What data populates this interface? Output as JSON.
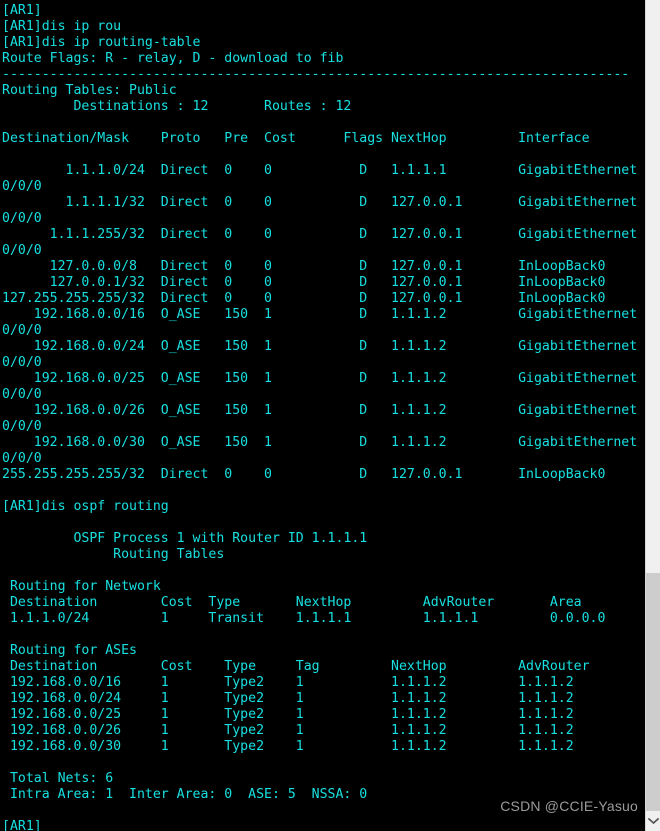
{
  "terminal": {
    "device_prompt": "[AR1]",
    "foreground_color": "#18e0e0",
    "background_color": "#000000",
    "commands": [
      "dis ip rou",
      "dis ip routing-table",
      "dis ospf routing"
    ],
    "lines": [
      "[AR1]",
      "[AR1]dis ip rou",
      "[AR1]dis ip routing-table",
      "Route Flags: R - relay, D - download to fib",
      "-------------------------------------------------------------------------------",
      "Routing Tables: Public",
      "         Destinations : 12       Routes : 12",
      "",
      "Destination/Mask    Proto   Pre  Cost      Flags NextHop         Interface",
      "",
      "        1.1.1.0/24  Direct  0    0           D   1.1.1.1         GigabitEthernet",
      "0/0/0",
      "        1.1.1.1/32  Direct  0    0           D   127.0.0.1       GigabitEthernet",
      "0/0/0",
      "      1.1.1.255/32  Direct  0    0           D   127.0.0.1       GigabitEthernet",
      "0/0/0",
      "      127.0.0.0/8   Direct  0    0           D   127.0.0.1       InLoopBack0",
      "      127.0.0.1/32  Direct  0    0           D   127.0.0.1       InLoopBack0",
      "127.255.255.255/32  Direct  0    0           D   127.0.0.1       InLoopBack0",
      "    192.168.0.0/16  O_ASE   150  1           D   1.1.1.2         GigabitEthernet",
      "0/0/0",
      "    192.168.0.0/24  O_ASE   150  1           D   1.1.1.2         GigabitEthernet",
      "0/0/0",
      "    192.168.0.0/25  O_ASE   150  1           D   1.1.1.2         GigabitEthernet",
      "0/0/0",
      "    192.168.0.0/26  O_ASE   150  1           D   1.1.1.2         GigabitEthernet",
      "0/0/0",
      "    192.168.0.0/30  O_ASE   150  1           D   1.1.1.2         GigabitEthernet",
      "0/0/0",
      "255.255.255.255/32  Direct  0    0           D   127.0.0.1       InLoopBack0",
      "",
      "[AR1]dis ospf routing",
      "",
      "         OSPF Process 1 with Router ID 1.1.1.1",
      "              Routing Tables",
      "",
      " Routing for Network",
      " Destination        Cost  Type       NextHop         AdvRouter       Area",
      " 1.1.1.0/24         1     Transit    1.1.1.1         1.1.1.1         0.0.0.0",
      "",
      " Routing for ASEs",
      " Destination        Cost    Type     Tag         NextHop         AdvRouter",
      " 192.168.0.0/16     1       Type2    1           1.1.1.2         1.1.1.2",
      " 192.168.0.0/24     1       Type2    1           1.1.1.2         1.1.1.2",
      " 192.168.0.0/25     1       Type2    1           1.1.1.2         1.1.1.2",
      " 192.168.0.0/26     1       Type2    1           1.1.1.2         1.1.1.2",
      " 192.168.0.0/30     1       Type2    1           1.1.1.2         1.1.1.2",
      "",
      " Total Nets: 6",
      " Intra Area: 1  Inter Area: 0  ASE: 5  NSSA: 0",
      "",
      "[AR1]"
    ],
    "route_flags_legend": "Route Flags: R - relay, D - download to fib",
    "routing_table_name": "Routing Tables: Public",
    "destinations_count": "12",
    "routes_count": "12",
    "ip_route_table": {
      "headers": [
        "Destination/Mask",
        "Proto",
        "Pre",
        "Cost",
        "Flags",
        "NextHop",
        "Interface"
      ],
      "rows": [
        [
          "1.1.1.0/24",
          "Direct",
          "0",
          "0",
          "D",
          "1.1.1.1",
          "GigabitEthernet0/0/0"
        ],
        [
          "1.1.1.1/32",
          "Direct",
          "0",
          "0",
          "D",
          "127.0.0.1",
          "GigabitEthernet0/0/0"
        ],
        [
          "1.1.1.255/32",
          "Direct",
          "0",
          "0",
          "D",
          "127.0.0.1",
          "GigabitEthernet0/0/0"
        ],
        [
          "127.0.0.0/8",
          "Direct",
          "0",
          "0",
          "D",
          "127.0.0.1",
          "InLoopBack0"
        ],
        [
          "127.0.0.1/32",
          "Direct",
          "0",
          "0",
          "D",
          "127.0.0.1",
          "InLoopBack0"
        ],
        [
          "127.255.255.255/32",
          "Direct",
          "0",
          "0",
          "D",
          "127.0.0.1",
          "InLoopBack0"
        ],
        [
          "192.168.0.0/16",
          "O_ASE",
          "150",
          "1",
          "D",
          "1.1.1.2",
          "GigabitEthernet0/0/0"
        ],
        [
          "192.168.0.0/24",
          "O_ASE",
          "150",
          "1",
          "D",
          "1.1.1.2",
          "GigabitEthernet0/0/0"
        ],
        [
          "192.168.0.0/25",
          "O_ASE",
          "150",
          "1",
          "D",
          "1.1.1.2",
          "GigabitEthernet0/0/0"
        ],
        [
          "192.168.0.0/26",
          "O_ASE",
          "150",
          "1",
          "D",
          "1.1.1.2",
          "GigabitEthernet0/0/0"
        ],
        [
          "192.168.0.0/30",
          "O_ASE",
          "150",
          "1",
          "D",
          "1.1.1.2",
          "GigabitEthernet0/0/0"
        ],
        [
          "255.255.255.255/32",
          "Direct",
          "0",
          "0",
          "D",
          "127.0.0.1",
          "InLoopBack0"
        ]
      ]
    },
    "ospf": {
      "process_header": "OSPF Process 1 with Router ID 1.1.1.1",
      "tables_header": "Routing Tables",
      "network_section_title": "Routing for Network",
      "network_headers": [
        "Destination",
        "Cost",
        "Type",
        "NextHop",
        "AdvRouter",
        "Area"
      ],
      "network_rows": [
        [
          "1.1.1.0/24",
          "1",
          "Transit",
          "1.1.1.1",
          "1.1.1.1",
          "0.0.0.0"
        ]
      ],
      "ase_section_title": "Routing for ASEs",
      "ase_headers": [
        "Destination",
        "Cost",
        "Type",
        "Tag",
        "NextHop",
        "AdvRouter"
      ],
      "ase_rows": [
        [
          "192.168.0.0/16",
          "1",
          "Type2",
          "1",
          "1.1.1.2",
          "1.1.1.2"
        ],
        [
          "192.168.0.0/24",
          "1",
          "Type2",
          "1",
          "1.1.1.2",
          "1.1.1.2"
        ],
        [
          "192.168.0.0/25",
          "1",
          "Type2",
          "1",
          "1.1.1.2",
          "1.1.1.2"
        ],
        [
          "192.168.0.0/26",
          "1",
          "Type2",
          "1",
          "1.1.1.2",
          "1.1.1.2"
        ],
        [
          "192.168.0.0/30",
          "1",
          "Type2",
          "1",
          "1.1.1.2",
          "1.1.1.2"
        ]
      ],
      "total_nets": "6",
      "intra_area": "1",
      "inter_area": "0",
      "ase": "5",
      "nssa": "0",
      "total_nets_line": "Total Nets: 6",
      "summary_line": "Intra Area: 1  Inter Area: 0  ASE: 5  NSSA: 0"
    }
  },
  "scrollbar": {
    "down_arrow_icon": "chevron-down-icon",
    "thumb_color": "#cdcdcd",
    "track_color": "#f0f0f0"
  },
  "watermark": {
    "text": "CSDN @CCIE-Yasuo",
    "color": "#9b9b9b"
  }
}
